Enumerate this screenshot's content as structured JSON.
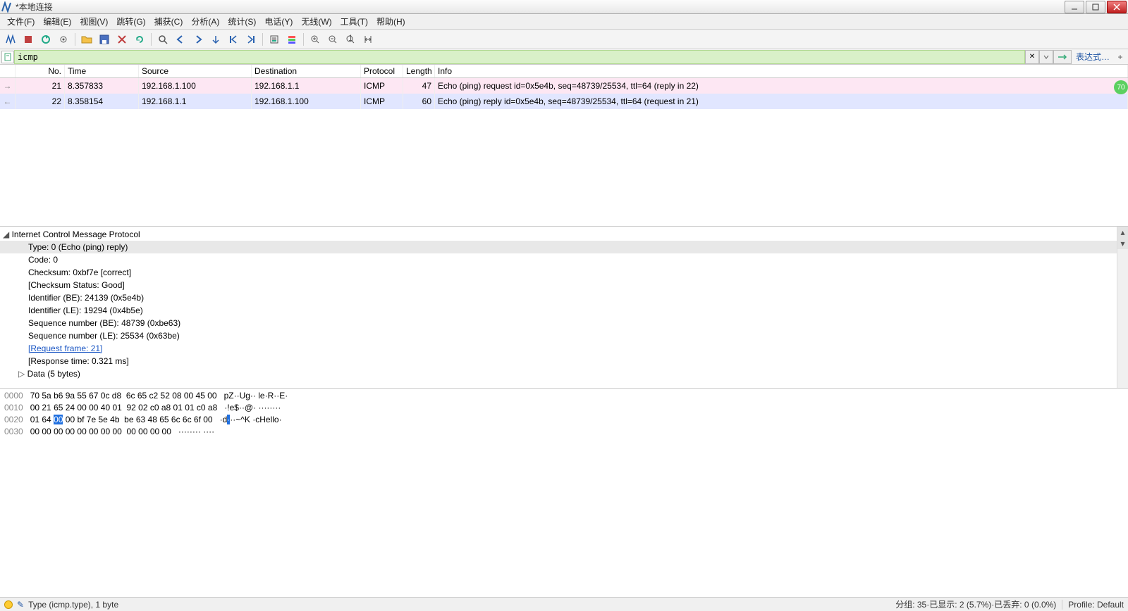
{
  "window": {
    "title": "*本地连接"
  },
  "menus": [
    "文件(F)",
    "编辑(E)",
    "视图(V)",
    "跳转(G)",
    "捕获(C)",
    "分析(A)",
    "统计(S)",
    "电话(Y)",
    "无线(W)",
    "工具(T)",
    "帮助(H)"
  ],
  "filter": {
    "value": "icmp",
    "expr_label": "表达式…"
  },
  "columns": {
    "no": "No.",
    "time": "Time",
    "src": "Source",
    "dst": "Destination",
    "proto": "Protocol",
    "len": "Length",
    "info": "Info"
  },
  "packets": [
    {
      "no": "21",
      "time": "8.357833",
      "src": "192.168.1.100",
      "dst": "192.168.1.1",
      "proto": "ICMP",
      "len": "47",
      "info": "Echo (ping) request  id=0x5e4b, seq=48739/25534, ttl=64 (reply in 22)",
      "cls": "req",
      "arrow": "→"
    },
    {
      "no": "22",
      "time": "8.358154",
      "src": "192.168.1.1",
      "dst": "192.168.1.100",
      "proto": "ICMP",
      "len": "60",
      "info": "Echo (ping) reply   id=0x5e4b, seq=48739/25534, ttl=64 (request in 21)",
      "cls": "rep",
      "arrow": "←"
    }
  ],
  "badge": "70",
  "details": {
    "header": "Internet Control Message Protocol",
    "lines": [
      "Type: 0 (Echo (ping) reply)",
      "Code: 0",
      "Checksum: 0xbf7e [correct]",
      "[Checksum Status: Good]",
      "Identifier (BE): 24139 (0x5e4b)",
      "Identifier (LE): 19294 (0x4b5e)",
      "Sequence number (BE): 48739 (0xbe63)",
      "Sequence number (LE): 25534 (0x63be)"
    ],
    "link": "[Request frame: 21]",
    "after_link": "[Response time: 0.321 ms]",
    "data_line": "Data (5 bytes)"
  },
  "hex": {
    "rows": [
      {
        "off": "0000",
        "b": "70 5a b6 9a 55 67 0c d8  6c 65 c2 52 08 00 45 00",
        "a": "pZ··Ug·· le·R··E·"
      },
      {
        "off": "0010",
        "b": "00 21 65 24 00 00 40 01  92 02 c0 a8 01 01 c0 a8",
        "a": "·!e$··@· ········"
      },
      {
        "off": "0020",
        "b_pre": "01 64 ",
        "b_hl": "00",
        "b_post": " 00 bf 7e 5e 4b  be 63 48 65 6c 6c 6f 00",
        "a_pre": "·d",
        "a_hl": "·",
        "a_post": "··~^K ·cHello·"
      },
      {
        "off": "0030",
        "b": "00 00 00 00 00 00 00 00  00 00 00 00",
        "a": "········ ····"
      }
    ]
  },
  "status": {
    "field": "Type (icmp.type), 1 byte",
    "groups": "分组: 35 ",
    "shown": " 已显示: 2 (5.7%) ",
    "dropped": " 已丢弃: 0 (0.0%)",
    "profile": "Profile: Default"
  },
  "icons": {
    "shark": "shark",
    "folder": "folder",
    "save": "save",
    "close": "close",
    "find": "find",
    "back": "back",
    "fwd": "fwd",
    "goto": "goto",
    "gofirst": "first",
    "golast": "last",
    "autoscroll": "autoscroll",
    "colorize": "colorize",
    "zoomin": "zoom+",
    "zoomout": "zoom-",
    "zoom1": "zoom1",
    "resize": "resize"
  }
}
